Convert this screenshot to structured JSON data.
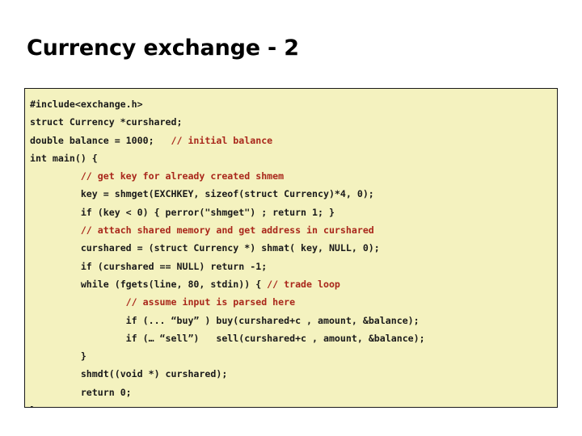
{
  "slide": {
    "title": "Currency exchange - 2",
    "background_color": "#ffffff",
    "code_box": {
      "background_color": "#f4f2bf",
      "border_color": "#1a1a1a",
      "code_color": "#1a1a1a",
      "comment_color": "#a9271b",
      "language": "c",
      "lines": [
        {
          "indent": "",
          "segments": [
            {
              "kind": "code",
              "text": "#include<exchange.h>"
            }
          ]
        },
        {
          "indent": "",
          "segments": [
            {
              "kind": "code",
              "text": "struct Currency *curshared;"
            }
          ]
        },
        {
          "indent": "",
          "segments": [
            {
              "kind": "code",
              "text": "double balance = 1000;   "
            },
            {
              "kind": "comment",
              "text": "// initial balance"
            }
          ]
        },
        {
          "indent": "",
          "segments": [
            {
              "kind": "code",
              "text": "int main() {"
            }
          ]
        },
        {
          "indent": "         ",
          "segments": [
            {
              "kind": "comment",
              "text": "// get key for already created shmem"
            }
          ]
        },
        {
          "indent": "         ",
          "segments": [
            {
              "kind": "code",
              "text": "key = shmget(EXCHKEY, sizeof(struct Currency)*4, 0);"
            }
          ]
        },
        {
          "indent": "         ",
          "segments": [
            {
              "kind": "code",
              "text": "if (key < 0) { perror(\"shmget\") ; return 1; }"
            }
          ]
        },
        {
          "indent": "         ",
          "segments": [
            {
              "kind": "comment",
              "text": "// attach shared memory and get address in curshared"
            }
          ]
        },
        {
          "indent": "         ",
          "segments": [
            {
              "kind": "code",
              "text": "curshared = (struct Currency *) shmat( key, NULL, 0);"
            }
          ]
        },
        {
          "indent": "         ",
          "segments": [
            {
              "kind": "code",
              "text": "if (curshared == NULL) return -1;"
            }
          ]
        },
        {
          "indent": "         ",
          "segments": [
            {
              "kind": "code",
              "text": "while (fgets(line, 80, stdin)) { "
            },
            {
              "kind": "comment",
              "text": "// trade loop"
            }
          ]
        },
        {
          "indent": "                 ",
          "segments": [
            {
              "kind": "comment",
              "text": "// assume input is parsed here"
            }
          ]
        },
        {
          "indent": "                 ",
          "segments": [
            {
              "kind": "code",
              "text": "if (... “buy” ) buy(curshared+c , amount, &balance);"
            }
          ]
        },
        {
          "indent": "                 ",
          "segments": [
            {
              "kind": "code",
              "text": "if (… “sell”)   sell(curshared+c , amount, &balance);"
            }
          ]
        },
        {
          "indent": "         ",
          "segments": [
            {
              "kind": "code",
              "text": "}"
            }
          ]
        },
        {
          "indent": "         ",
          "segments": [
            {
              "kind": "code",
              "text": "shmdt((void *) curshared);"
            }
          ]
        },
        {
          "indent": "         ",
          "segments": [
            {
              "kind": "code",
              "text": "return 0;"
            }
          ]
        },
        {
          "indent": "",
          "segments": [
            {
              "kind": "code",
              "text": "}"
            }
          ]
        }
      ]
    }
  }
}
